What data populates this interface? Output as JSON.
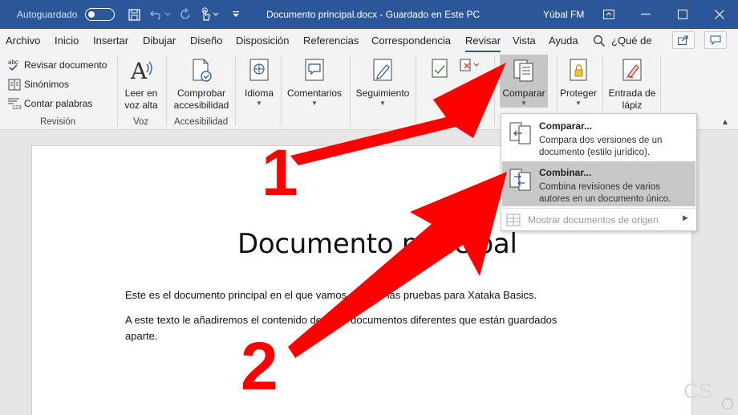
{
  "titlebar": {
    "autosave_label": "Autoguardado",
    "document_title": "Documento principal.docx  -  Guardado en Este PC",
    "user_name": "Yúbal FM"
  },
  "tabs": [
    "Archivo",
    "Inicio",
    "Insertar",
    "Dibujar",
    "Diseño",
    "Disposición",
    "Referencias",
    "Correspondencia",
    "Revisar",
    "Vista",
    "Ayuda"
  ],
  "active_tab": "Revisar",
  "search_label": "¿Qué de",
  "ribbon": {
    "revision": {
      "items": [
        "Revisar documento",
        "Sinónimos",
        "Contar palabras"
      ],
      "abc_label": "abc",
      "count_label": "123",
      "group_label": "Revisión"
    },
    "voz": {
      "button": [
        "Leer en",
        "voz alta"
      ],
      "group_label": "Voz"
    },
    "accesibilidad": {
      "button": [
        "Comprobar",
        "accesibilidad"
      ],
      "group_label": "Accesibilidad"
    },
    "idioma": {
      "button": "Idioma"
    },
    "comentarios": {
      "button": "Comentarios"
    },
    "seguimiento": {
      "button": "Seguimiento"
    },
    "cambios": {
      "group_label_fragment": "os"
    },
    "comparar": {
      "button": "Comparar"
    },
    "proteger": {
      "button": "Proteger"
    },
    "entrada": {
      "button": [
        "Entrada de",
        "lápiz"
      ]
    }
  },
  "dropdown": {
    "items": [
      {
        "title": "Comparar...",
        "description": "Compara dos versiones de un documento (estilo jurídico)."
      },
      {
        "title": "Combinar...",
        "description": "Combina revisiones de varios autores en un documento único."
      }
    ],
    "more": "Mostrar documentos de origen"
  },
  "document": {
    "heading": "Documento principal",
    "paragraph1": "Este es el documento principal en el que vamos a hacer las pruebas para Xataka Basics.",
    "paragraph2_line1": "A este texto le añadiremos el contenido de otros documentos diferentes que están guardados",
    "paragraph2_line2": "aparte."
  },
  "annotations": {
    "arrow1_label": "1",
    "arrow2_label": "2",
    "arrow_color": "#ff0000"
  },
  "watermark": "CS",
  "colors": {
    "titlebar": "#2b579a",
    "ribbon": "#f3f3f3",
    "hover": "#c8c8c8"
  }
}
